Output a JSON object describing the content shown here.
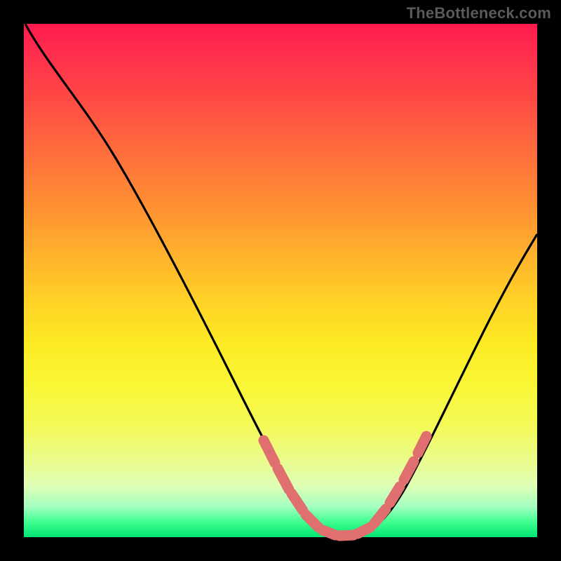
{
  "watermark": "TheBottleneck.com",
  "colors": {
    "frame": "#000000",
    "curve_stroke": "#000000",
    "marker_fill": "#e57373",
    "gradient_top": "#ff1a4d",
    "gradient_bottom": "#00e574"
  },
  "chart_data": {
    "type": "line",
    "title": "",
    "xlabel": "",
    "ylabel": "",
    "xlim": [
      0,
      100
    ],
    "ylim": [
      0,
      100
    ],
    "grid": false,
    "legend": false,
    "series": [
      {
        "name": "bottleneck-curve",
        "x": [
          0,
          5,
          10,
          15,
          20,
          25,
          30,
          35,
          40,
          45,
          50,
          55,
          58,
          60,
          63,
          66,
          70,
          75,
          80,
          85,
          90,
          95,
          100
        ],
        "y": [
          100,
          97,
          93,
          87,
          80,
          71,
          61,
          50,
          38,
          26,
          15,
          6,
          2,
          1,
          0,
          1,
          3,
          9,
          17,
          27,
          38,
          49,
          59
        ]
      }
    ],
    "markers": {
      "name": "highlight-points",
      "x": [
        49,
        51,
        53,
        55,
        57,
        59,
        61,
        63,
        65,
        67,
        70,
        72,
        74,
        76
      ],
      "y": [
        16,
        12,
        8,
        5,
        3,
        1,
        0,
        0,
        1,
        2,
        4,
        7,
        10,
        14
      ]
    }
  }
}
